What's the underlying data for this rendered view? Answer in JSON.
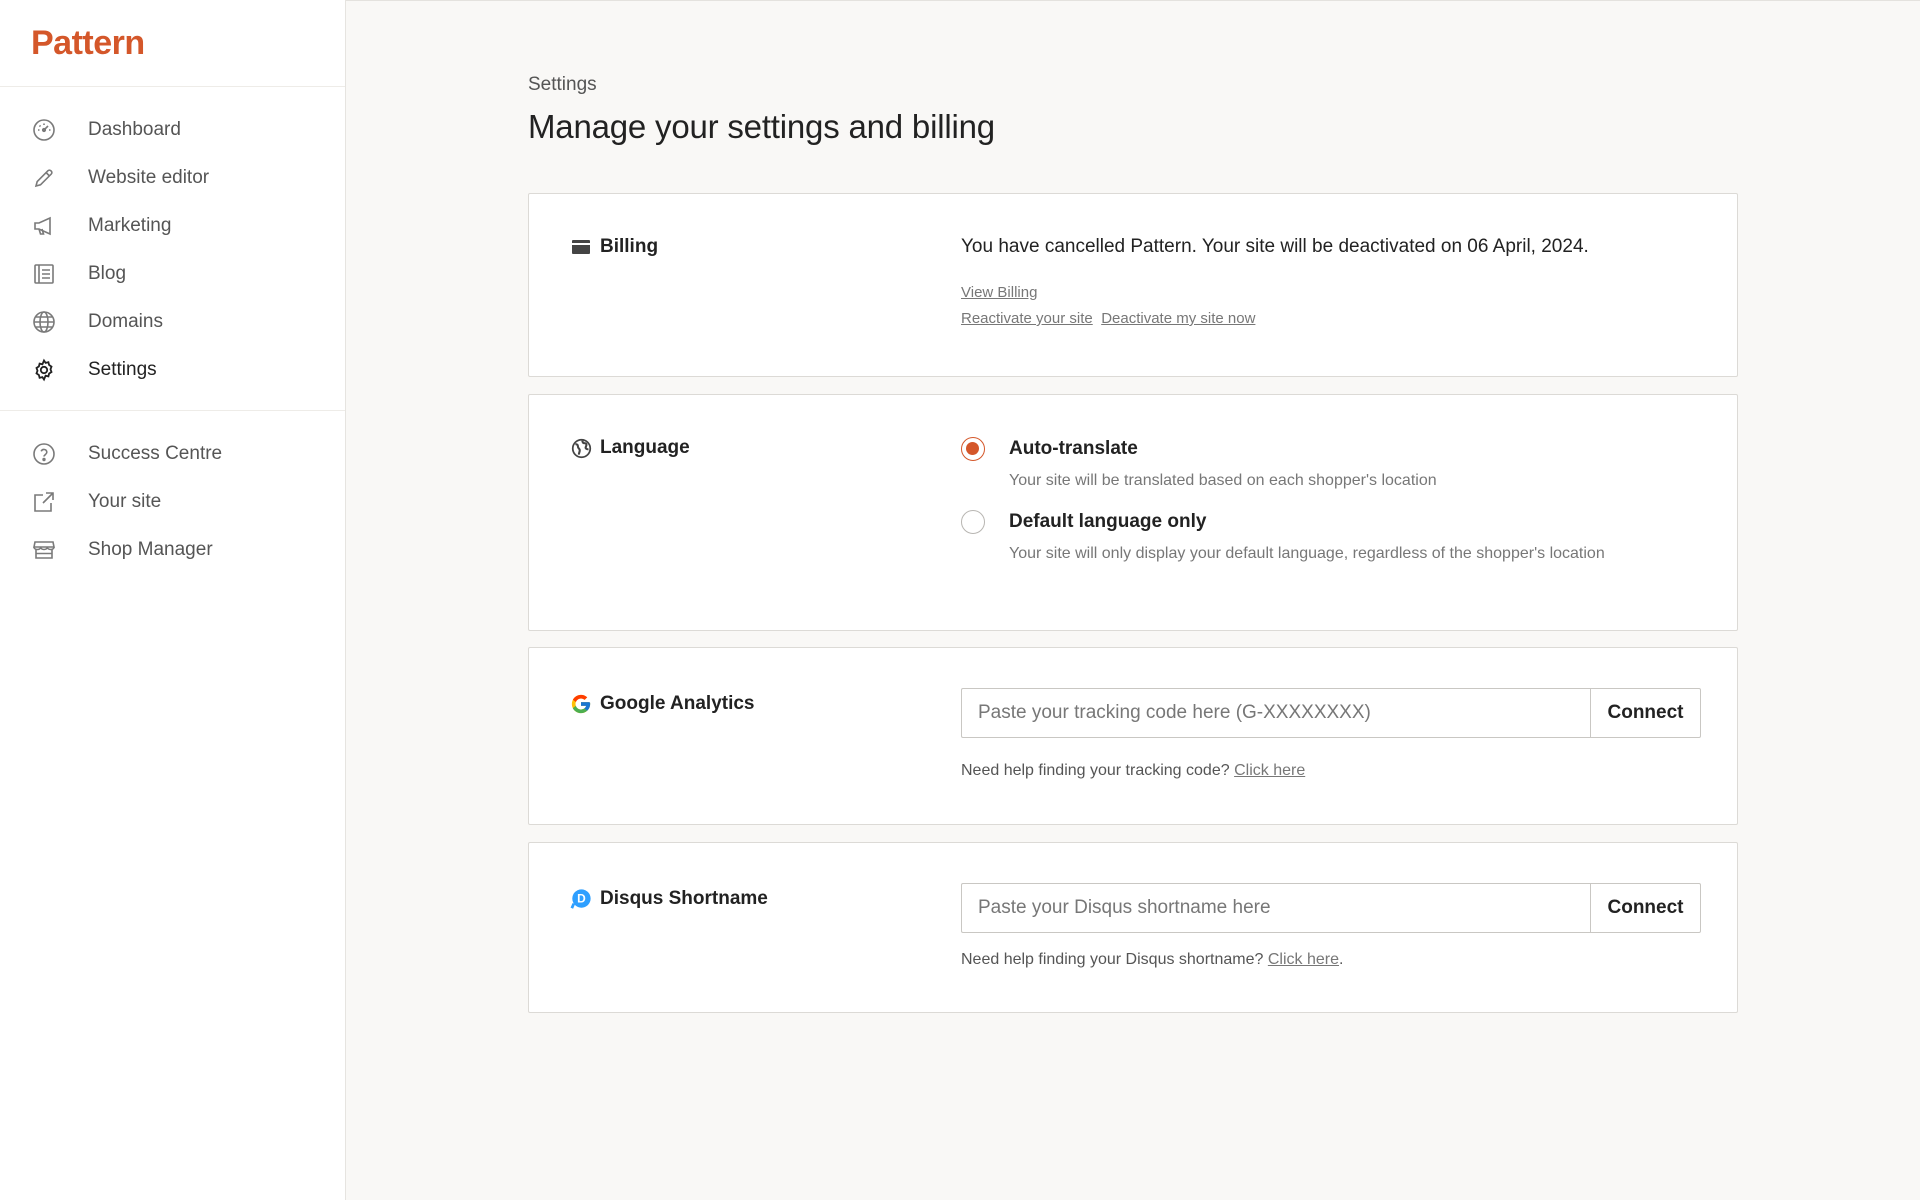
{
  "brand": {
    "name": "Pattern"
  },
  "sidebar": {
    "items": [
      {
        "label": "Dashboard",
        "icon": "dashboard-icon"
      },
      {
        "label": "Website editor",
        "icon": "pencil-icon"
      },
      {
        "label": "Marketing",
        "icon": "megaphone-icon"
      },
      {
        "label": "Blog",
        "icon": "blog-icon"
      },
      {
        "label": "Domains",
        "icon": "globe-icon"
      },
      {
        "label": "Settings",
        "icon": "gear-icon",
        "active": true
      }
    ],
    "secondary": [
      {
        "label": "Success Centre",
        "icon": "help-circle-icon"
      },
      {
        "label": "Your site",
        "icon": "external-link-icon"
      },
      {
        "label": "Shop Manager",
        "icon": "store-icon"
      }
    ]
  },
  "main": {
    "eyebrow": "Settings",
    "title": "Manage your settings and billing"
  },
  "billing": {
    "title": "Billing",
    "message": "You have cancelled Pattern. Your site will be deactivated on 06 April, 2024.",
    "view_billing": "View Billing",
    "reactivate": "Reactivate your site",
    "deactivate": "Deactivate my site now"
  },
  "language": {
    "title": "Language",
    "options": [
      {
        "label": "Auto-translate",
        "description": "Your site will be translated based on each shopper's location",
        "selected": true
      },
      {
        "label": "Default language only",
        "description": "Your site will only display your default language, regardless of the shopper's location",
        "selected": false
      }
    ]
  },
  "google_analytics": {
    "title": "Google Analytics",
    "placeholder": "Paste your tracking code here (G-XXXXXXXX)",
    "value": "",
    "button": "Connect",
    "help_text": "Need help finding your tracking code?",
    "help_link": "Click here"
  },
  "disqus": {
    "title": "Disqus Shortname",
    "placeholder": "Paste your Disqus shortname here",
    "value": "",
    "button": "Connect",
    "help_text": "Need help finding your Disqus shortname?",
    "help_link": "Click here",
    "help_suffix": "."
  },
  "colors": {
    "accent": "#d4572a",
    "background": "#f9f8f6",
    "card": "#ffffff",
    "google_blue": "#4285F4",
    "disqus_blue": "#2E9FFF"
  }
}
